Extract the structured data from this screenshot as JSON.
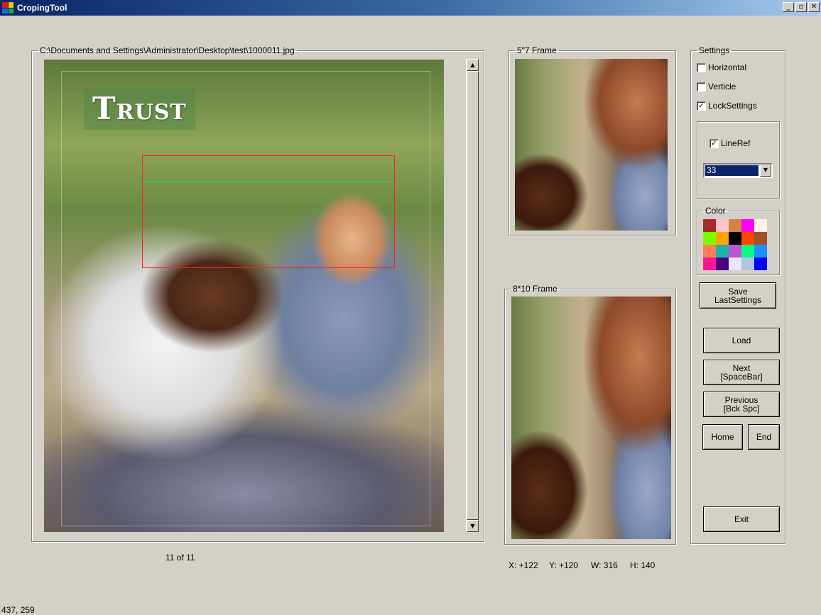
{
  "window": {
    "title": "CropingTool",
    "controls": {
      "minimize": "_",
      "restore": "▫",
      "close": "✕"
    }
  },
  "image_panel": {
    "path": "C:\\Documents and Settings\\Administrator\\Desktop\\test\\1000011.jpg",
    "logo_initial": "T",
    "logo_rest": "RUST"
  },
  "counter": "11 of 11",
  "frames": {
    "five_by_seven": "5\"7 Frame",
    "eight_by_ten": "8*10 Frame"
  },
  "crop_info": {
    "x": "X: +122",
    "y": "Y: +120",
    "w": "W: 316",
    "h": "H: 140"
  },
  "settings": {
    "title": "Settings",
    "horizontal": {
      "label": "Horizontal",
      "checked": false
    },
    "verticle": {
      "label": "Verticle",
      "checked": false
    },
    "lock_settings": {
      "label": "LockSettings",
      "checked": true
    },
    "line_ref": {
      "label": "LineRef",
      "checked": true
    },
    "line_ref_value": "33",
    "color_title": "Color",
    "colors": [
      "#a52a2a",
      "#ffc0cb",
      "#cd853f",
      "#ff00ff",
      "#fff0e8",
      "#7cfc00",
      "#ffa500",
      "#000000",
      "#ff4500",
      "#a0522d",
      "#ff7f50",
      "#20b2aa",
      "#ba55d3",
      "#00ff7f",
      "#1e90ff",
      "#ff1493",
      "#4b0082",
      "#e6e6fa",
      "#b0c4de",
      "#0000ff"
    ],
    "check_mark": "✓"
  },
  "buttons": {
    "save_line1": "Save",
    "save_line2": "LastSettings",
    "load": "Load",
    "next_line1": "Next",
    "next_line2": "[SpaceBar]",
    "previous_line1": "Previous",
    "previous_line2": "[Bck Spc]",
    "home": "Home",
    "end": "End",
    "exit": "Exit"
  },
  "mouse_coords": "437, 259",
  "icons": {
    "scroll_up": "▲",
    "scroll_down": "▼",
    "combo_arrow": "▼"
  }
}
